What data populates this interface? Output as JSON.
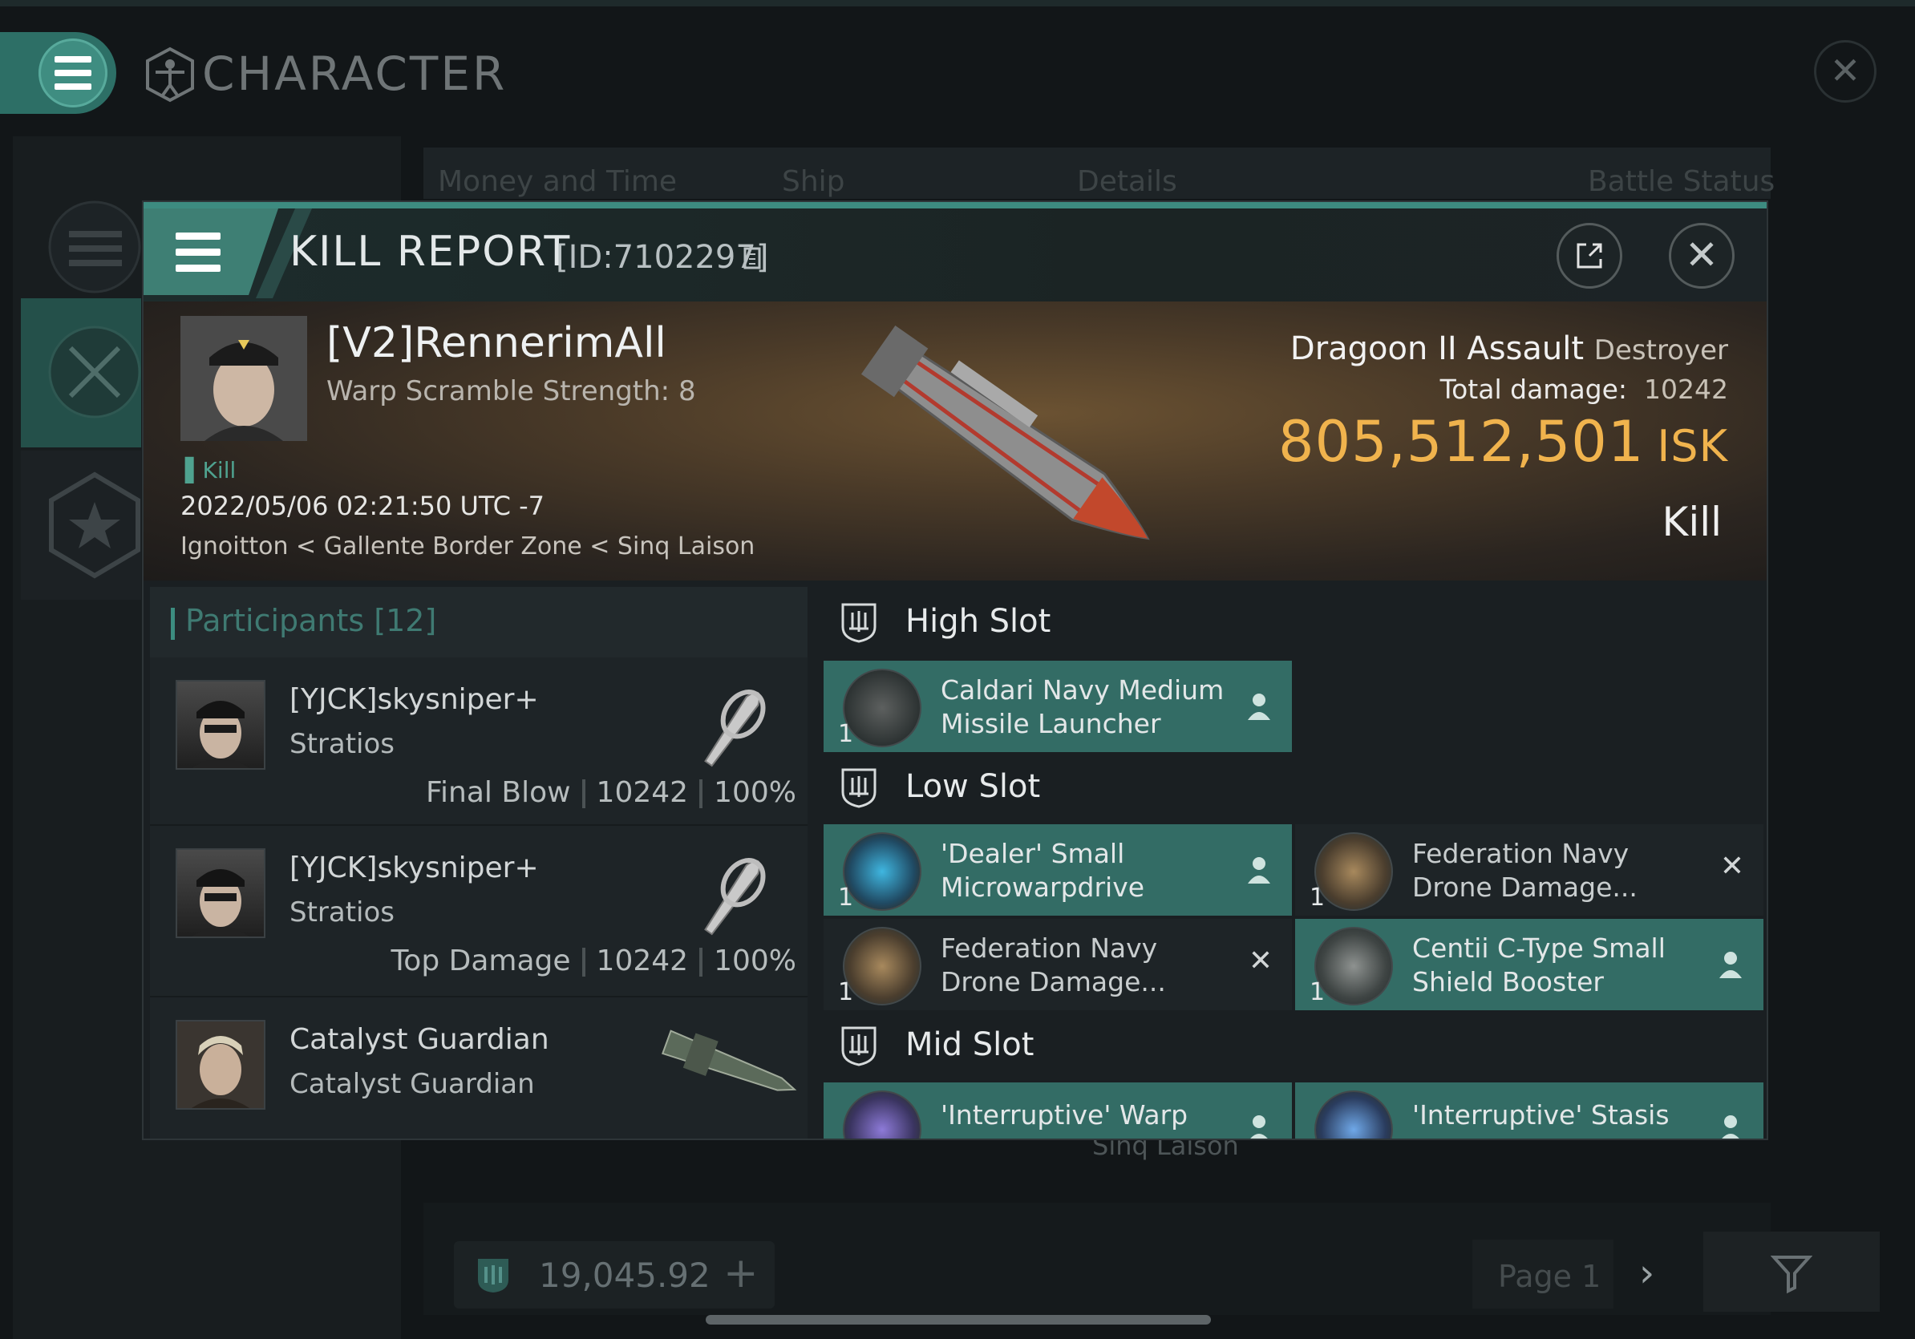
{
  "app": {
    "title": "CHARACTER",
    "bg_tabs": [
      "Money and Time",
      "Ship",
      "Details",
      "Battle Status"
    ],
    "bg_location": "Sinq Laison",
    "isk_balance": "19,045.92",
    "page_label": "Page 1"
  },
  "kill_report": {
    "title": "KILL REPORT",
    "id_label": "[ID:7102297]",
    "victim": {
      "name": "[V2]RennerimAll",
      "subtitle": "Warp Scramble Strength: 8",
      "tag": "Kill",
      "datetime": "2022/05/06 02:21:50 UTC -7",
      "location": "Ignoitton < Gallente Border Zone < Sinq Laison"
    },
    "ship": {
      "name": "Dragoon II Assault",
      "class": "Destroyer",
      "damage_label": "Total damage:",
      "damage_value": "10242",
      "isk_value": "805,512,501",
      "isk_unit": "ISK",
      "result": "Kill"
    },
    "participants": {
      "title": "Participants [12]",
      "rows": [
        {
          "name": "[YJCK]skysniper+",
          "ship": "Stratios",
          "role": "Final Blow",
          "damage": "10242",
          "percent": "100%"
        },
        {
          "name": "[YJCK]skysniper+",
          "ship": "Stratios",
          "role": "Top Damage",
          "damage": "10242",
          "percent": "100%"
        },
        {
          "name": "Catalyst Guardian",
          "ship": "Catalyst Guardian",
          "role": "",
          "damage": "",
          "percent": ""
        }
      ]
    },
    "fitting": {
      "high_slot": {
        "title": "High Slot",
        "items": [
          {
            "name": "Caldari Navy Medium Missile Launcher",
            "qty": "1",
            "state": "fitted"
          }
        ]
      },
      "low_slot": {
        "title": "Low Slot",
        "items": [
          {
            "name": "'Dealer' Small Microwarpdrive",
            "qty": "1",
            "state": "fitted"
          },
          {
            "name": "Federation Navy Drone Damage...",
            "qty": "1",
            "state": "destroyed"
          },
          {
            "name": "Federation Navy Drone Damage...",
            "qty": "1",
            "state": "destroyed"
          },
          {
            "name": "Centii C-Type Small Shield Booster",
            "qty": "1",
            "state": "fitted"
          }
        ]
      },
      "mid_slot": {
        "title": "Mid Slot",
        "items": [
          {
            "name": "'Interruptive' Warp",
            "qty": "1",
            "state": "fitted"
          },
          {
            "name": "'Interruptive' Stasis",
            "qty": "1",
            "state": "fitted"
          }
        ]
      }
    }
  },
  "colors": {
    "accent_teal": "#3d8b80",
    "item_fitted_bg": "#336c65",
    "isk_gold": "#f0b34d"
  },
  "icons": [
    "hamburger-icon",
    "vitruvian-icon",
    "close-icon",
    "share-icon",
    "copy-icon",
    "slot-shield-icon",
    "pilot-icon",
    "x-destroyed-icon",
    "crossed-swords-icon",
    "star-icon",
    "filter-icon",
    "chevron-right-icon",
    "plus-icon",
    "isk-icon"
  ]
}
